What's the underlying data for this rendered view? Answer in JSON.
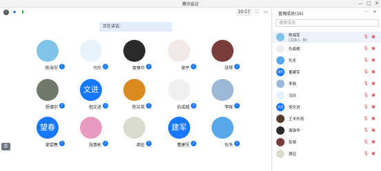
{
  "window": {
    "title": "腾讯会议",
    "min_glyph": "—",
    "max_glyph": "□",
    "close_glyph": "✕"
  },
  "toolbar": {
    "time": "10:17",
    "info_glyph": "i",
    "shield_glyph": "◆",
    "signal_glyph": "▮",
    "fullscreen_glyph": "⛶",
    "layout_glyph": "▭"
  },
  "speaking": {
    "label": "正在讲话:"
  },
  "participants": [
    {
      "name": "陈海军",
      "avatar_text": "",
      "avatar_color": "#7fc4e8"
    },
    {
      "name": "马玲",
      "avatar_text": "",
      "avatar_color": "#e8f2fb"
    },
    {
      "name": "袁锋华",
      "avatar_text": "",
      "avatar_color": "#2a2a2a"
    },
    {
      "name": "邹平",
      "avatar_text": "",
      "avatar_color": "#f2e8e6"
    },
    {
      "name": "张琴",
      "avatar_text": "",
      "avatar_color": "#7a3b3b"
    },
    {
      "name": "杨潜宇",
      "avatar_text": "",
      "avatar_color": "#6f7a6a"
    },
    {
      "name": "倪文进",
      "avatar_text": "文进",
      "avatar_color": "#1677ff"
    },
    {
      "name": "陈兰英",
      "avatar_text": "",
      "avatar_color": "#d98b1e"
    },
    {
      "name": "仇成威",
      "avatar_text": "",
      "avatar_color": "#f0f0f0"
    },
    {
      "name": "李政",
      "avatar_text": "",
      "avatar_color": "#9bb9d6"
    },
    {
      "name": "邹望春",
      "avatar_text": "望春",
      "avatar_color": "#1677ff"
    },
    {
      "name": "张惠彬",
      "avatar_text": "",
      "avatar_color": "#e89ac0"
    },
    {
      "name": "周征",
      "avatar_text": "",
      "avatar_color": "#d7dccd"
    },
    {
      "name": "董建军",
      "avatar_text": "建军",
      "avatar_color": "#1677ff"
    },
    {
      "name": "仇冬",
      "avatar_text": "",
      "avatar_color": "#58a7e8"
    }
  ],
  "panel": {
    "title": "管理成员(16)",
    "more_glyph": "···",
    "close_glyph": "✕",
    "search_placeholder": "搜索成员",
    "members": [
      {
        "name": "陈海军",
        "sub": "(主持人, 我)",
        "avatar_text": "",
        "avatar_color": "#7fc4e8"
      },
      {
        "name": "仇成威",
        "sub": "",
        "avatar_text": "",
        "avatar_color": "#eeeeee"
      },
      {
        "name": "仇冬",
        "sub": "",
        "avatar_text": "",
        "avatar_color": "#58a7e8"
      },
      {
        "name": "董建军",
        "sub": "",
        "avatar_text": "建军",
        "avatar_color": "#1677ff"
      },
      {
        "name": "李政",
        "sub": "",
        "avatar_text": "",
        "avatar_color": "#9bb9d6"
      },
      {
        "name": "马玲",
        "sub": "",
        "avatar_text": "",
        "avatar_color": "#e8f2fb"
      },
      {
        "name": "倪文进",
        "sub": "",
        "avatar_text": "文进",
        "avatar_color": "#1677ff"
      },
      {
        "name": "王木东雨",
        "sub": "",
        "avatar_text": "",
        "avatar_color": "#5a3a2a"
      },
      {
        "name": "袁锋华",
        "sub": "",
        "avatar_text": "",
        "avatar_color": "#2a2a2a"
      },
      {
        "name": "张琴",
        "sub": "",
        "avatar_text": "",
        "avatar_color": "#7a3b3b"
      },
      {
        "name": "周征",
        "sub": "",
        "avatar_text": "",
        "avatar_color": "#d7dccd"
      }
    ],
    "mic_glyph": "🎙",
    "cam_glyph": "▣"
  },
  "chat_glyph": "☰"
}
